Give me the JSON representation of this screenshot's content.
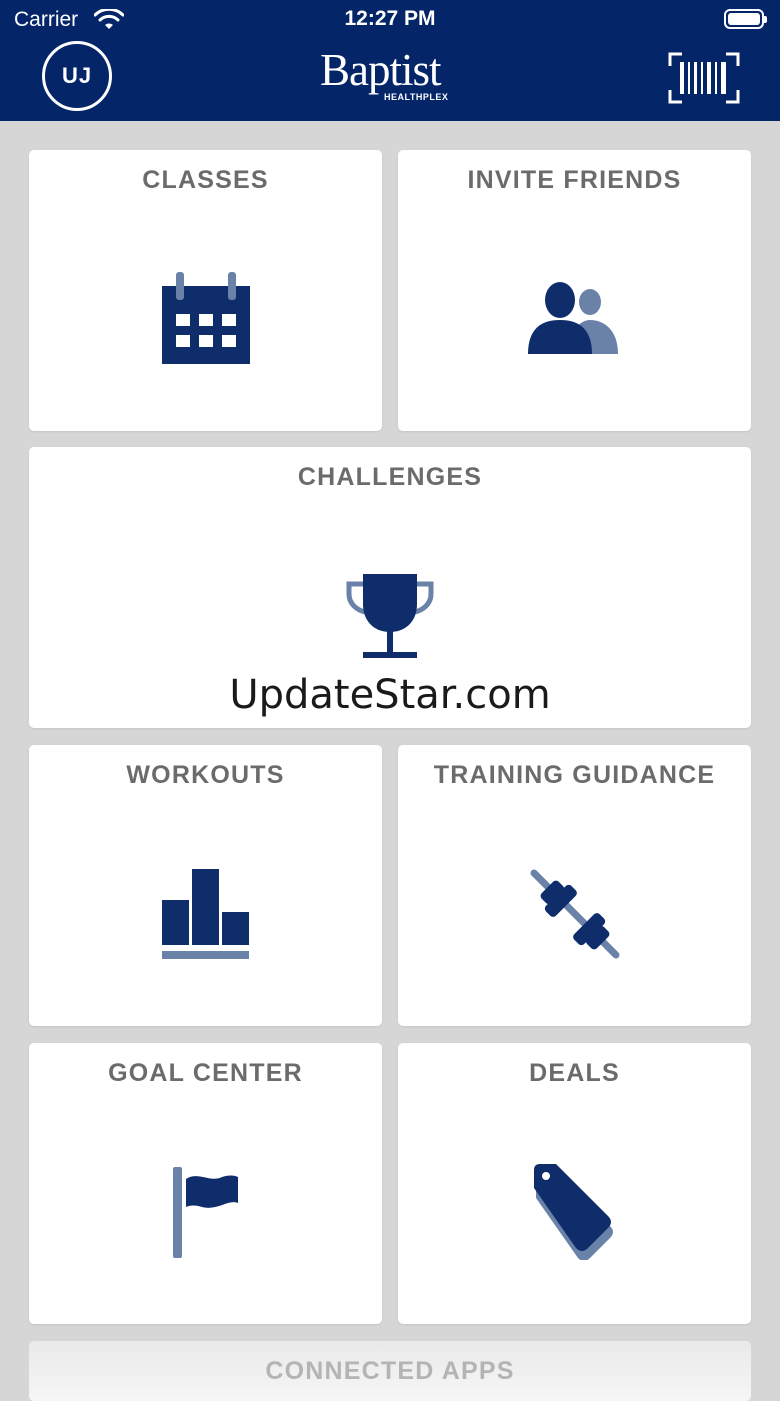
{
  "status_bar": {
    "carrier": "Carrier",
    "time": "12:27 PM"
  },
  "header": {
    "avatar_initials": "UJ",
    "logo_word": "Baptist",
    "logo_subtitle": "HEALTHPLEX",
    "barcode_icon": "barcode-icon"
  },
  "tiles": [
    {
      "label": "CLASSES",
      "icon": "calendar-icon"
    },
    {
      "label": "INVITE FRIENDS",
      "icon": "people-icon"
    },
    {
      "label": "CHALLENGES",
      "icon": "trophy-icon"
    },
    {
      "label": "WORKOUTS",
      "icon": "bar-chart-icon"
    },
    {
      "label": "TRAINING GUIDANCE",
      "icon": "dumbbell-icon"
    },
    {
      "label": "GOAL CENTER",
      "icon": "flag-icon"
    },
    {
      "label": "DEALS",
      "icon": "tag-icon"
    },
    {
      "label": "CONNECTED APPS",
      "icon": ""
    }
  ],
  "watermark": "UpdateStar.com",
  "colors": {
    "navy": "#052569",
    "icon_primary": "#0f2d6b",
    "icon_secondary": "#6a81a8",
    "background": "#d6d6d6"
  }
}
